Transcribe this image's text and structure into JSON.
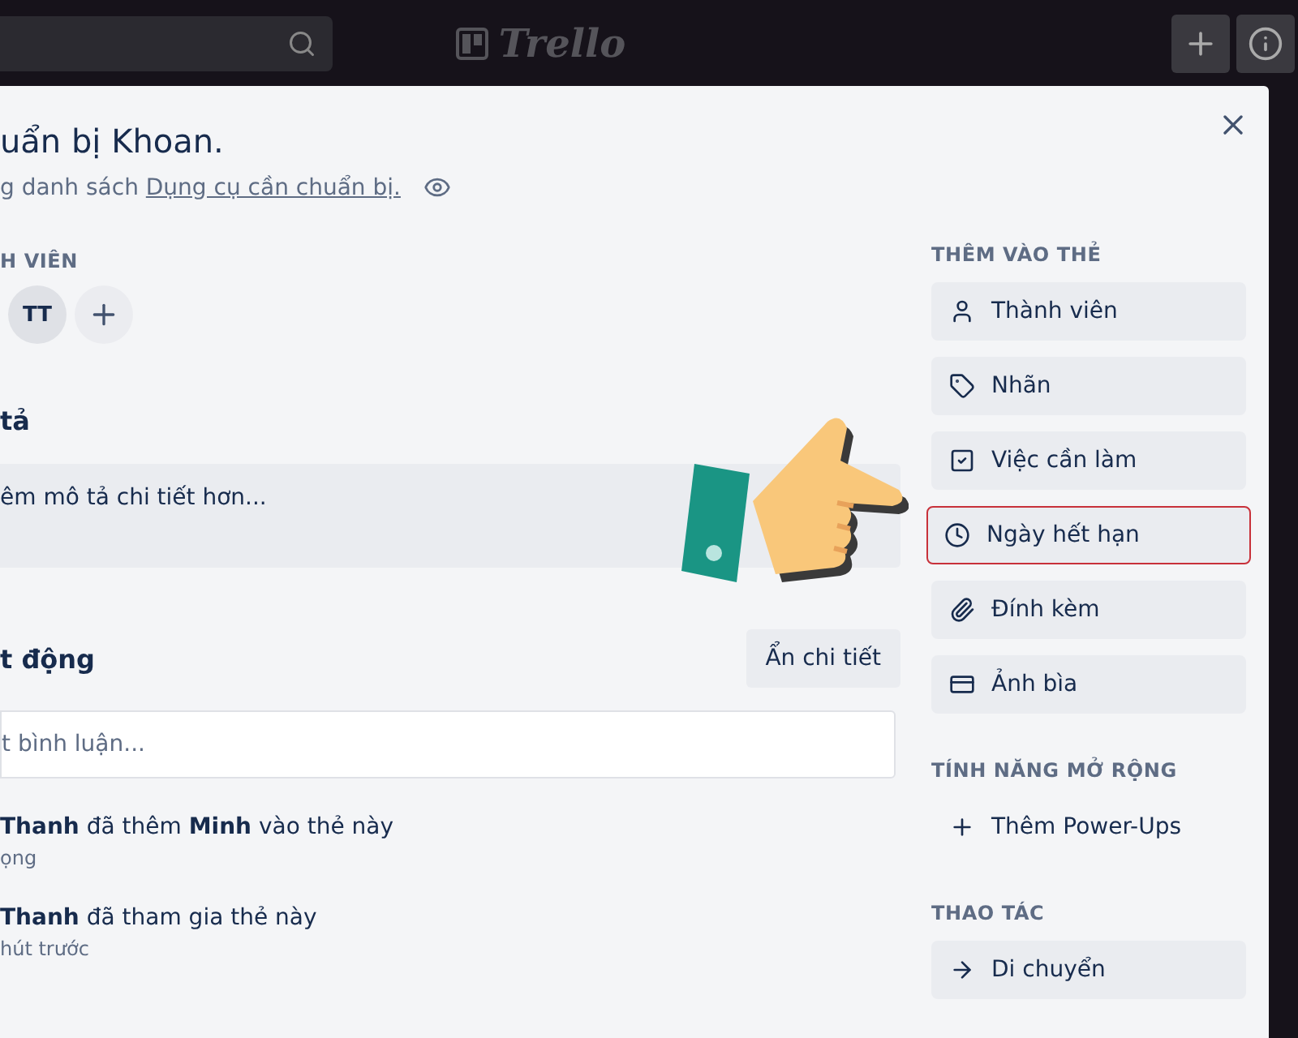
{
  "top_bar": {
    "logo": "Trello"
  },
  "card": {
    "title": "uẩn bị Khoan.",
    "list_prefix": "g danh sách ",
    "list_link": "Dụng cụ cần chuẩn bị.",
    "members_label": "H VIÊN",
    "members": [
      "TT"
    ],
    "description_heading": "tả",
    "description_placeholder": "êm mô tả chi tiết hơn...",
    "activity_heading": "t động",
    "hide_details": "Ẩn chi tiết",
    "comment_placeholder": "t bình luận...",
    "activities": [
      {
        "text": "**Thanh** đã thêm **Minh** vào thẻ này",
        "time": "ọng"
      },
      {
        "text": "**Thanh** đã tham gia thẻ này",
        "time": "hút trước"
      }
    ]
  },
  "sidebar": [
    {
      "heading": "THÊM VÀO THẺ",
      "items": [
        {
          "kind": "member",
          "label": "Thành viên",
          "highlighted": false
        },
        {
          "kind": "label",
          "label": "Nhãn",
          "highlighted": false
        },
        {
          "kind": "checklist",
          "label": "Việc cần làm",
          "highlighted": false
        },
        {
          "kind": "due",
          "label": "Ngày hết hạn",
          "highlighted": true
        },
        {
          "kind": "attach",
          "label": "Đính kèm",
          "highlighted": false
        },
        {
          "kind": "cover",
          "label": "Ảnh bìa",
          "highlighted": false
        }
      ]
    },
    {
      "heading": "TÍNH NĂNG MỞ RỘNG",
      "items": [
        {
          "kind": "add",
          "label": "Thêm Power-Ups",
          "highlighted": false
        }
      ]
    },
    {
      "heading": "THAO TÁC",
      "items": [
        {
          "kind": "move",
          "label": "Di chuyển",
          "highlighted": false
        }
      ]
    }
  ]
}
